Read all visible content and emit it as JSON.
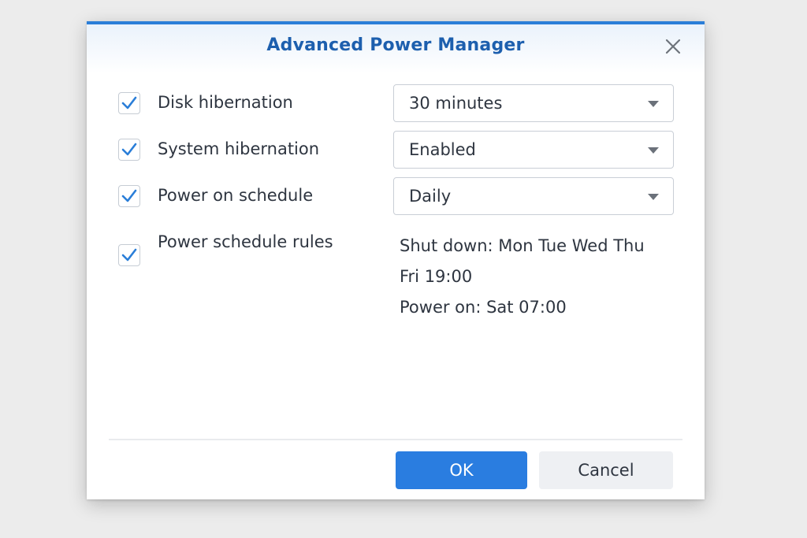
{
  "dialog": {
    "title": "Advanced Power Manager",
    "accent_color": "#2a7ed8",
    "title_color": "#1d5fae",
    "close_icon": "close-icon"
  },
  "settings": [
    {
      "label": "Disk hibernation",
      "checked": true,
      "value": "30 minutes"
    },
    {
      "label": "System hibernation",
      "checked": true,
      "value": "Enabled"
    },
    {
      "label": "Power on schedule",
      "checked": true,
      "value": "Daily"
    }
  ],
  "schedule_rules": {
    "label": "Power schedule rules",
    "checked": true,
    "line1": "Shut down: Mon Tue Wed Thu",
    "line2": "Fri 19:00",
    "line3": "Power on: Sat 07:00"
  },
  "footer": {
    "ok_label": "OK",
    "cancel_label": "Cancel",
    "ok_color": "#2a7de0"
  }
}
